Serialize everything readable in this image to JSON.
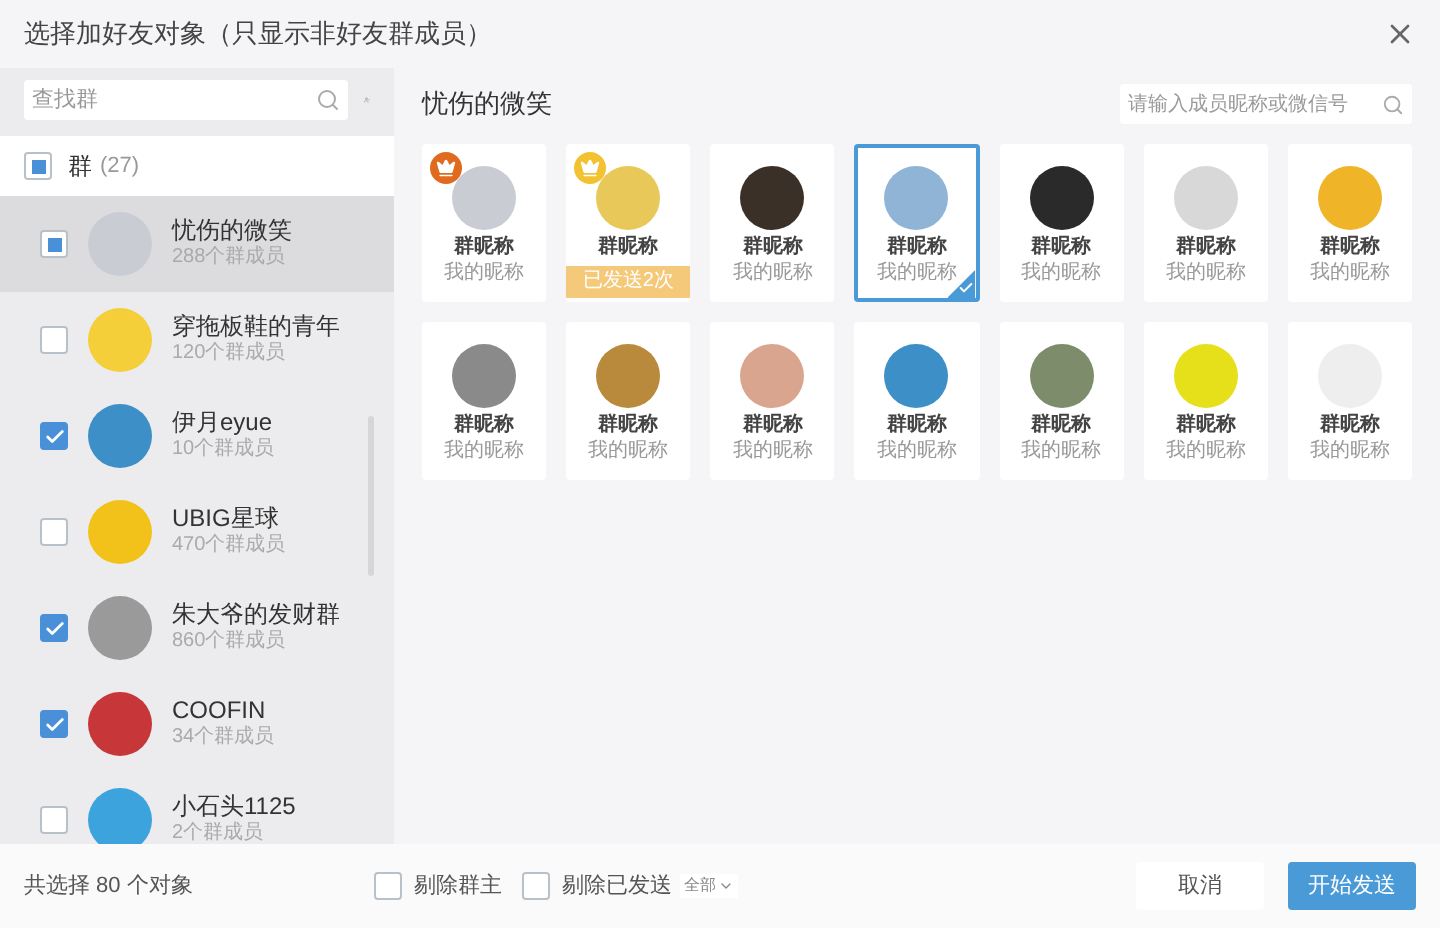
{
  "window": {
    "title": "选择加好友对象（只显示非好友群成员）"
  },
  "sidebar": {
    "search": {
      "placeholder": "查找群"
    },
    "header": {
      "label": "群",
      "count": "(27)",
      "checked": true,
      "partial": true
    },
    "groups": [
      {
        "name": "忧伤的微笑",
        "members": "288个群成员",
        "checked": true,
        "partial": true,
        "selected": true
      },
      {
        "name": "穿拖板鞋的青年",
        "members": "120个群成员",
        "checked": false,
        "selected": false
      },
      {
        "name": "伊月eyue",
        "members": "10个群成员",
        "checked": true,
        "selected": false
      },
      {
        "name": "UBIG星球",
        "members": "470个群成员",
        "checked": false,
        "selected": false
      },
      {
        "name": "朱大爷的发财群",
        "members": "860个群成员",
        "checked": true,
        "selected": false
      },
      {
        "name": "COOFIN",
        "members": "34个群成员",
        "checked": true,
        "selected": false
      },
      {
        "name": "小石头1125",
        "members": "2个群成员",
        "checked": false,
        "selected": false
      }
    ]
  },
  "main": {
    "title": "忧伤的微笑",
    "search": {
      "placeholder": "请输入成员昵称或微信号"
    },
    "members": [
      {
        "group_nick": "群昵称",
        "nick": "我的昵称",
        "selected": false,
        "crown": true,
        "color": "#e06a1e"
      },
      {
        "group_nick": "群昵称",
        "selected": false,
        "crown": true,
        "color": "#f2c230",
        "sent": "已发送2次"
      },
      {
        "group_nick": "群昵称",
        "nick": "我的昵称",
        "selected": false,
        "crown": false
      },
      {
        "group_nick": "群昵称",
        "nick": "我的昵称",
        "selected": true,
        "crown": false
      },
      {
        "group_nick": "群昵称",
        "nick": "我的昵称",
        "selected": false,
        "crown": false
      },
      {
        "group_nick": "群昵称",
        "nick": "我的昵称",
        "selected": false,
        "crown": false
      },
      {
        "group_nick": "群昵称",
        "nick": "我的昵称",
        "selected": false,
        "crown": false
      },
      {
        "group_nick": "群昵称",
        "nick": "我的昵称",
        "selected": false,
        "crown": false
      },
      {
        "group_nick": "群昵称",
        "nick": "我的昵称",
        "selected": false,
        "crown": false
      },
      {
        "group_nick": "群昵称",
        "nick": "我的昵称",
        "selected": false,
        "crown": false
      },
      {
        "group_nick": "群昵称",
        "nick": "我的昵称",
        "selected": false,
        "crown": false
      },
      {
        "group_nick": "群昵称",
        "nick": "我的昵称",
        "selected": false,
        "crown": false
      },
      {
        "group_nick": "群昵称",
        "nick": "我的昵称",
        "selected": false,
        "crown": false
      },
      {
        "group_nick": "群昵称",
        "nick": "我的昵称",
        "selected": false,
        "crown": false
      }
    ]
  },
  "footer": {
    "summary": "共选择 80 个对象",
    "options": [
      {
        "label": "剔除群主",
        "checked": false
      },
      {
        "label": "剔除已发送",
        "checked": false
      }
    ],
    "filter": "全部",
    "buttons": [
      {
        "label": "取消",
        "kind": "secondary"
      },
      {
        "label": "开始发送",
        "kind": "primary"
      }
    ]
  }
}
